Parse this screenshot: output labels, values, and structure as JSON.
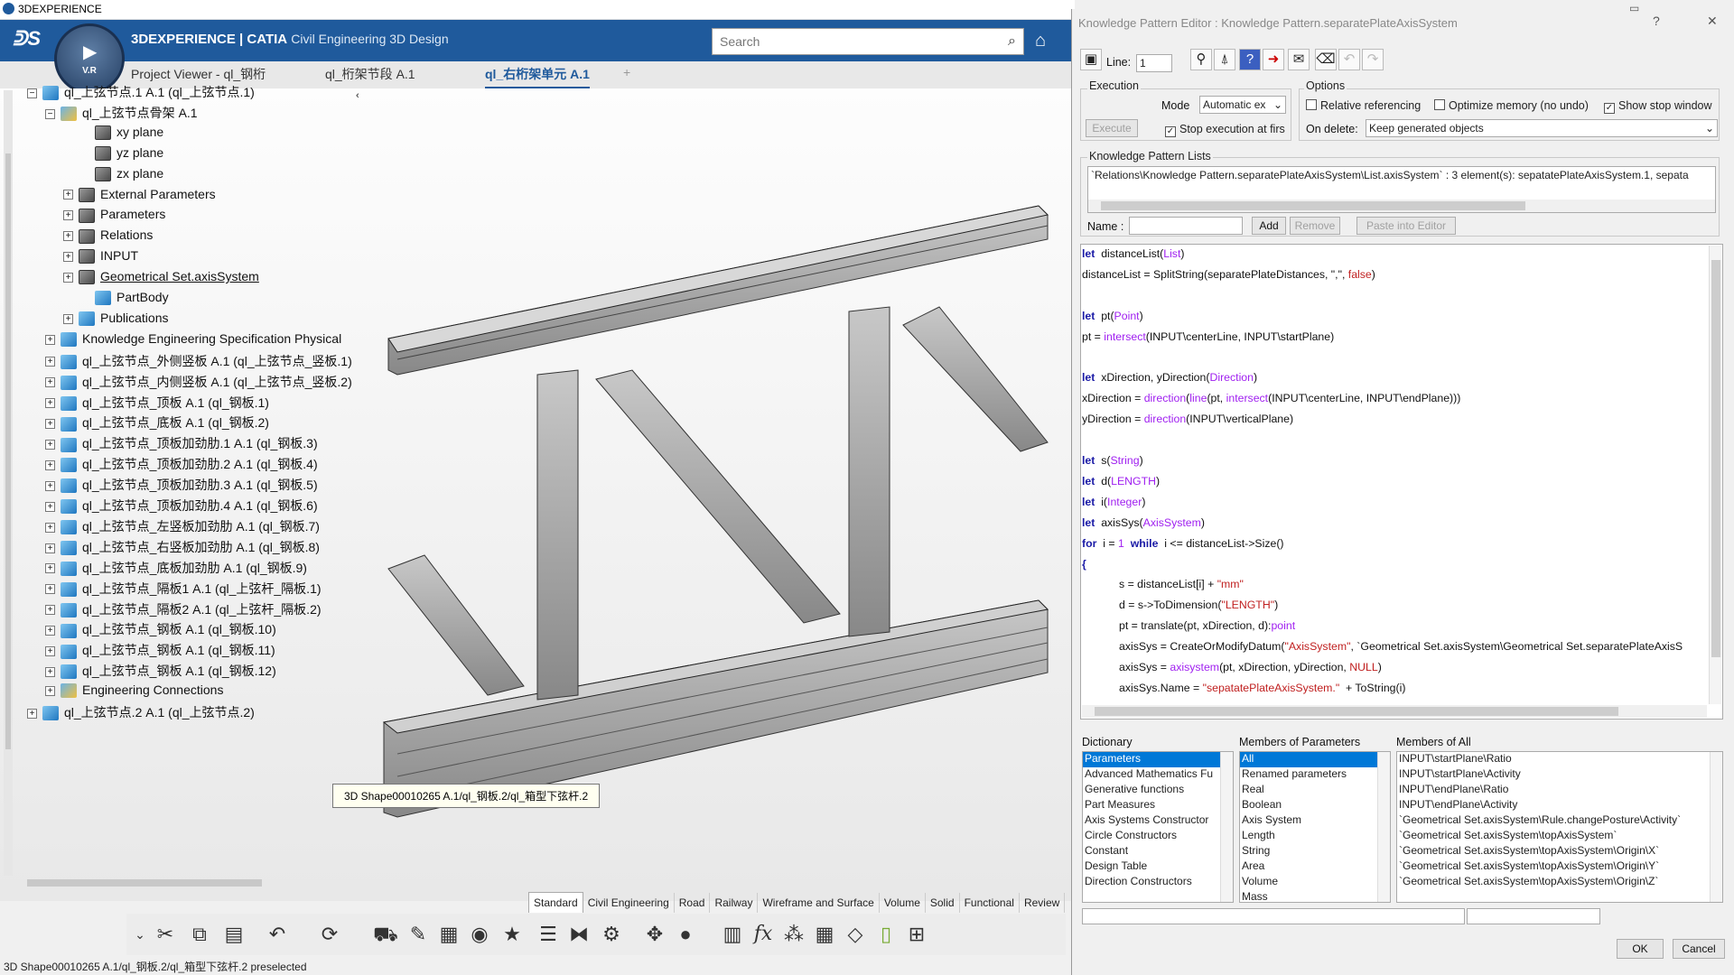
{
  "window_title": "3DEXPERIENCE",
  "app": {
    "brand": "3DEXPERIENCE | CATIA",
    "module": "Civil Engineering 3D Design",
    "compass_label": "V.R"
  },
  "search": {
    "placeholder": "Search"
  },
  "tabs": [
    {
      "label": "Project Viewer - ql_钢桁"
    },
    {
      "label": "ql_桁架节段 A.1"
    },
    {
      "label": "ql_右桁架单元 A.1",
      "active": true
    },
    {
      "label": "+"
    }
  ],
  "tree": [
    {
      "label": "ql_上弦节点.1 A.1 (ql_上弦节点.1)",
      "icon": "product-icon"
    },
    {
      "label": "ql_上弦节点骨架 A.1",
      "icon": "part-icon"
    },
    {
      "label": "xy plane",
      "icon": "plane-icon"
    },
    {
      "label": "yz plane",
      "icon": "plane-icon"
    },
    {
      "label": "zx plane",
      "icon": "plane-icon"
    },
    {
      "label": "External Parameters",
      "icon": "parameters-icon"
    },
    {
      "label": "Parameters",
      "icon": "parameters-icon"
    },
    {
      "label": "Relations",
      "icon": "relations-icon"
    },
    {
      "label": "INPUT",
      "icon": "input-icon"
    },
    {
      "label": "Geometrical Set.axisSystem",
      "icon": "geometrical-set-icon"
    },
    {
      "label": "PartBody",
      "icon": "partbody-icon"
    },
    {
      "label": "Publications",
      "icon": "publications-icon"
    },
    {
      "label": "Knowledge Engineering Specification Physical",
      "icon": "knowledge-icon"
    },
    {
      "label": "ql_上弦节点_外侧竖板 A.1 (ql_上弦节点_竖板.1)",
      "icon": "product-icon"
    },
    {
      "label": "ql_上弦节点_内侧竖板 A.1 (ql_上弦节点_竖板.2)",
      "icon": "product-icon"
    },
    {
      "label": "ql_上弦节点_顶板 A.1 (ql_钢板.1)",
      "icon": "product-icon"
    },
    {
      "label": "ql_上弦节点_底板 A.1 (ql_钢板.2)",
      "icon": "product-icon"
    },
    {
      "label": "ql_上弦节点_顶板加劲肋.1 A.1 (ql_钢板.3)",
      "icon": "product-icon"
    },
    {
      "label": "ql_上弦节点_顶板加劲肋.2 A.1 (ql_钢板.4)",
      "icon": "product-icon"
    },
    {
      "label": "ql_上弦节点_顶板加劲肋.3 A.1 (ql_钢板.5)",
      "icon": "product-icon"
    },
    {
      "label": "ql_上弦节点_顶板加劲肋.4 A.1 (ql_钢板.6)",
      "icon": "product-icon"
    },
    {
      "label": "ql_上弦节点_左竖板加劲肋 A.1 (ql_钢板.7)",
      "icon": "product-icon"
    },
    {
      "label": "ql_上弦节点_右竖板加劲肋 A.1 (ql_钢板.8)",
      "icon": "product-icon"
    },
    {
      "label": "ql_上弦节点_底板加劲肋 A.1 (ql_钢板.9)",
      "icon": "product-icon"
    },
    {
      "label": "ql_上弦节点_隔板1 A.1 (ql_上弦杆_隔板.1)",
      "icon": "product-icon"
    },
    {
      "label": "ql_上弦节点_隔板2 A.1 (ql_上弦杆_隔板.2)",
      "icon": "product-icon"
    },
    {
      "label": "ql_上弦节点_钢板 A.1 (ql_钢板.10)",
      "icon": "product-icon"
    },
    {
      "label": "ql_上弦节点_钢板 A.1 (ql_钢板.11)",
      "icon": "product-icon"
    },
    {
      "label": "ql_上弦节点_钢板 A.1 (ql_钢板.12)",
      "icon": "product-icon"
    },
    {
      "label": "Engineering Connections",
      "icon": "connections-icon"
    },
    {
      "label": "ql_上弦节点.2 A.1 (ql_上弦节点.2)",
      "icon": "product-icon"
    }
  ],
  "tooltip": "3D Shape00010265 A.1/ql_钢板.2/ql_箱型下弦杆.2",
  "bottom_tabs": [
    "Standard",
    "Civil Engineering",
    "Road",
    "Railway",
    "Wireframe and Surface",
    "Volume",
    "Solid",
    "Functional",
    "Review"
  ],
  "status_text": "3D Shape00010265 A.1/ql_钢板.2/ql_箱型下弦杆.2 preselected",
  "dialog": {
    "title": "Knowledge Pattern Editor : Knowledge Pattern.separatePlateAxisSystem",
    "line_label": "Line:",
    "line_value": "1",
    "execution_label": "Execution",
    "mode_label": "Mode",
    "mode_value": "Automatic ex",
    "execute_label": "Execute",
    "stop_exec_label": "Stop execution at firs",
    "options_label": "Options",
    "relative_ref": "Relative referencing",
    "optimize_mem": "Optimize memory (no undo)",
    "show_stop": "Show stop window",
    "on_delete_label": "On delete:",
    "on_delete_value": "Keep generated objects",
    "kp_lists_label": "Knowledge Pattern Lists",
    "kp_list_value": "`Relations\\Knowledge Pattern.separatePlateAxisSystem\\List.axisSystem` : 3 element(s): sepatatePlateAxisSystem.1, sepata",
    "name_label": "Name :",
    "add_label": "Add",
    "remove_label": "Remove",
    "paste_label": "Paste into Editor",
    "dictionary_label": "Dictionary",
    "members_params_label": "Members of Parameters",
    "members_all_label": "Members of All",
    "dictionary": [
      "Parameters",
      "Advanced Mathematics Fu",
      "Generative functions",
      "Part Measures",
      "Axis Systems Constructor",
      "Circle Constructors",
      "Constant",
      "Design Table",
      "Direction Constructors"
    ],
    "members_params": [
      "All",
      "Renamed parameters",
      "Real",
      "Boolean",
      "Axis System",
      "Length",
      "String",
      "Area",
      "Volume",
      "Mass"
    ],
    "members_all": [
      "INPUT\\startPlane\\Ratio",
      "INPUT\\startPlane\\Activity",
      "INPUT\\endPlane\\Ratio",
      "INPUT\\endPlane\\Activity",
      "`Geometrical Set.axisSystem\\Rule.changePosture\\Activity`",
      "`Geometrical Set.axisSystem\\topAxisSystem`",
      "`Geometrical Set.axisSystem\\topAxisSystem\\Origin\\X`",
      "`Geometrical Set.axisSystem\\topAxisSystem\\Origin\\Y`",
      "`Geometrical Set.axisSystem\\topAxisSystem\\Origin\\Z`"
    ],
    "ok_label": "OK",
    "cancel_label": "Cancel"
  },
  "code_lines": [
    [
      [
        "kw",
        "let"
      ],
      [
        "",
        "  distanceList("
      ],
      [
        "ty",
        "List"
      ],
      [
        "",
        ")"
      ]
    ],
    [
      [
        "",
        "distanceList = SplitString(separatePlateDistances, \",\", "
      ],
      [
        "str",
        "false"
      ],
      [
        "",
        ")"
      ]
    ],
    [],
    [
      [
        "kw",
        "let"
      ],
      [
        "",
        "  pt("
      ],
      [
        "ty",
        "Point"
      ],
      [
        "",
        ")"
      ]
    ],
    [
      [
        "",
        "pt = "
      ],
      [
        "fn",
        "intersect"
      ],
      [
        "",
        "(INPUT\\centerLine, INPUT\\startPlane)"
      ]
    ],
    [],
    [
      [
        "kw",
        "let"
      ],
      [
        "",
        "  xDirection, yDirection("
      ],
      [
        "ty",
        "Direction"
      ],
      [
        "",
        ")"
      ]
    ],
    [
      [
        "",
        "xDirection = "
      ],
      [
        "fn",
        "direction"
      ],
      [
        "",
        "("
      ],
      [
        "fn",
        "line"
      ],
      [
        "",
        "(pt, "
      ],
      [
        "fn",
        "intersect"
      ],
      [
        "",
        "(INPUT\\centerLine, INPUT\\endPlane)))"
      ]
    ],
    [
      [
        "",
        "yDirection = "
      ],
      [
        "fn",
        "direction"
      ],
      [
        "",
        "(INPUT\\verticalPlane)"
      ]
    ],
    [],
    [
      [
        "kw",
        "let"
      ],
      [
        "",
        "  s("
      ],
      [
        "ty",
        "String"
      ],
      [
        "",
        ")"
      ]
    ],
    [
      [
        "kw",
        "let"
      ],
      [
        "",
        "  d("
      ],
      [
        "ty",
        "LENGTH"
      ],
      [
        "",
        ")"
      ]
    ],
    [
      [
        "kw",
        "let"
      ],
      [
        "",
        "  i("
      ],
      [
        "ty",
        "Integer"
      ],
      [
        "",
        ")"
      ]
    ],
    [
      [
        "kw",
        "let"
      ],
      [
        "",
        "  axisSys("
      ],
      [
        "ty",
        "AxisSystem"
      ],
      [
        "",
        ")"
      ]
    ],
    [
      [
        "kw",
        "for"
      ],
      [
        "",
        "  i = "
      ],
      [
        "ty",
        "1"
      ],
      [
        "",
        "  "
      ],
      [
        "kw",
        "while"
      ],
      [
        "",
        "  i <= distanceList->Size()"
      ]
    ],
    [
      [
        "kw",
        "{"
      ]
    ],
    [
      [
        "",
        "            s = distanceList[i] + "
      ],
      [
        "str",
        "\"mm\""
      ]
    ],
    [
      [
        "",
        "            d = s->ToDimension("
      ],
      [
        "str",
        "\"LENGTH\""
      ],
      [
        "",
        ")"
      ]
    ],
    [
      [
        "",
        "            pt = translate(pt, xDirection, d):"
      ],
      [
        "fn",
        "point"
      ]
    ],
    [
      [
        "",
        "            axisSys = CreateOrModifyDatum("
      ],
      [
        "str",
        "\"AxisSystem\""
      ],
      [
        "",
        ", `Geometrical Set.axisSystem\\Geometrical Set.separatePlateAxisS"
      ]
    ],
    [
      [
        "",
        "            axisSys = "
      ],
      [
        "fn",
        "axisystem"
      ],
      [
        "",
        "(pt, xDirection, yDirection, "
      ],
      [
        "str",
        "NULL"
      ],
      [
        "",
        ")"
      ]
    ],
    [
      [
        "",
        "            axisSys.Name = "
      ],
      [
        "str",
        "\"sepatatePlateAxisSystem.\""
      ],
      [
        "",
        "  + ToString(i)"
      ]
    ]
  ],
  "colors": {
    "header_blue": "#1f5a9c",
    "keyword": "#1a1aa6",
    "type": "#a020f0",
    "string": "#c02020",
    "selection": "#0078d7"
  }
}
